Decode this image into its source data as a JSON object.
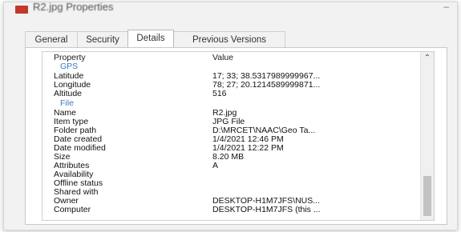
{
  "window": {
    "title": "R2.jpg Properties",
    "close_label": "–"
  },
  "tabs": [
    "General",
    "Security",
    "Details",
    "Previous Versions"
  ],
  "details": {
    "col_property": "Property",
    "col_value": "Value",
    "gps_group": "GPS",
    "file_group": "File",
    "gps": [
      {
        "prop": "Latitude",
        "val": "17; 33; 38.5317989999967..."
      },
      {
        "prop": "Longitude",
        "val": "78; 27; 20.1214589999871..."
      },
      {
        "prop": "Altitude",
        "val": "516"
      }
    ],
    "file": [
      {
        "prop": "Name",
        "val": "R2.jpg"
      },
      {
        "prop": "Item type",
        "val": "JPG File"
      },
      {
        "prop": "Folder path",
        "val": "D:\\MRCET\\NAAC\\Geo Ta..."
      },
      {
        "prop": "Date created",
        "val": "1/4/2021 12:46 PM"
      },
      {
        "prop": "Date modified",
        "val": "1/4/2021 12:22 PM"
      },
      {
        "prop": "Size",
        "val": "8.20 MB"
      },
      {
        "prop": "Attributes",
        "val": "A"
      },
      {
        "prop": "Availability",
        "val": ""
      },
      {
        "prop": "Offline status",
        "val": ""
      },
      {
        "prop": "Shared with",
        "val": ""
      },
      {
        "prop": "Owner",
        "val": "DESKTOP-H1M7JFS\\NUS..."
      },
      {
        "prop": "Computer",
        "val": "DESKTOP-H1M7JFS (this ..."
      }
    ]
  },
  "icons": {
    "window": "image-file-icon",
    "scroll_up": "chevron-up-icon"
  }
}
